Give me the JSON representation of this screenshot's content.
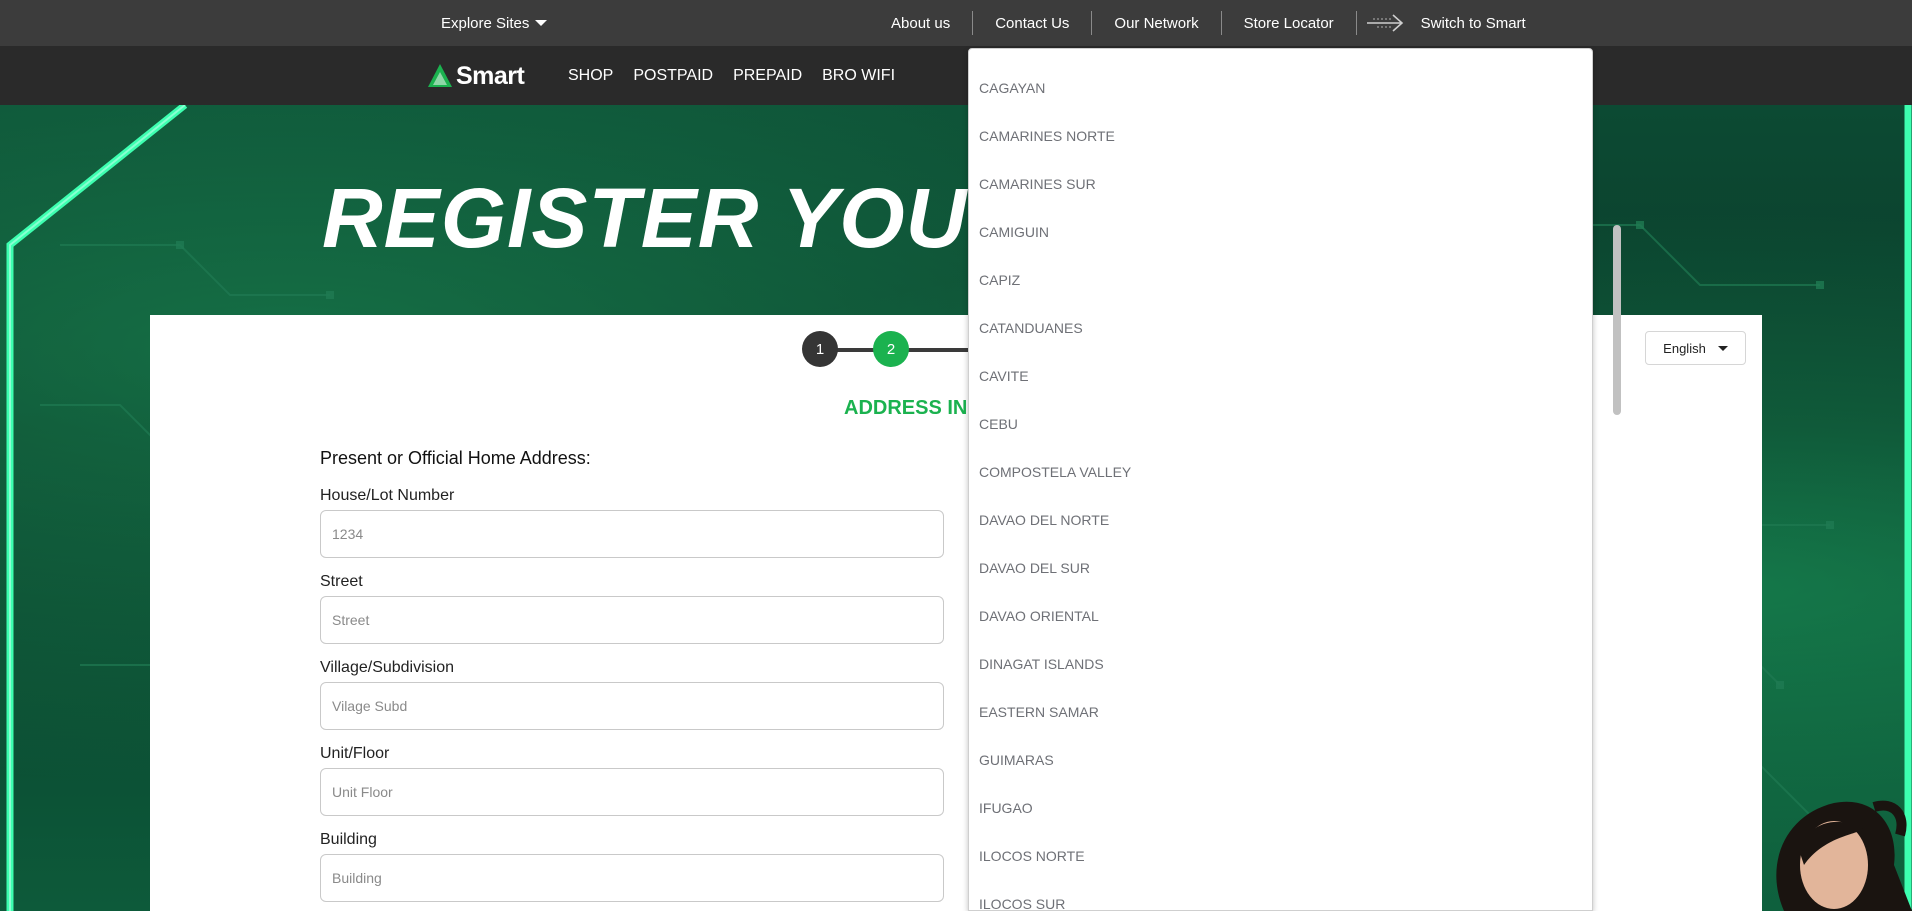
{
  "topbar": {
    "explore_label": "Explore Sites",
    "links": [
      "About us",
      "Contact Us",
      "Our Network",
      "Store Locator"
    ],
    "switch_label": "Switch to Smart"
  },
  "nav": {
    "logo_text": "Smart",
    "items": [
      "SHOP",
      "POSTPAID",
      "PREPAID",
      "BRO WIFI"
    ]
  },
  "hero": {
    "title": "REGISTER YOUR SI"
  },
  "form": {
    "steps": [
      "1",
      "2"
    ],
    "language": "English",
    "section_title": "ADDRESS INF",
    "heading": "Present or Official Home Address:",
    "fields": [
      {
        "label": "House/Lot Number",
        "placeholder": "1234"
      },
      {
        "label": "Street",
        "placeholder": "Street"
      },
      {
        "label": "Village/Subdivision",
        "placeholder": "Vilage Subd"
      },
      {
        "label": "Unit/Floor",
        "placeholder": "Unit Floor"
      },
      {
        "label": "Building",
        "placeholder": "Building"
      }
    ]
  },
  "province_dropdown": {
    "options": [
      "CAGAYAN",
      "CAMARINES NORTE",
      "CAMARINES SUR",
      "CAMIGUIN",
      "CAPIZ",
      "CATANDUANES",
      "CAVITE",
      "CEBU",
      "COMPOSTELA VALLEY",
      "DAVAO DEL NORTE",
      "DAVAO DEL SUR",
      "DAVAO ORIENTAL",
      "DINAGAT ISLANDS",
      "EASTERN SAMAR",
      "GUIMARAS",
      "IFUGAO",
      "ILOCOS NORTE",
      "ILOCOS SUR"
    ]
  },
  "colors": {
    "brand_green": "#1bb24f",
    "topbar_bg": "#3c3c3c",
    "nav_bg": "#2a2a2a",
    "option_text": "#6e7076"
  }
}
